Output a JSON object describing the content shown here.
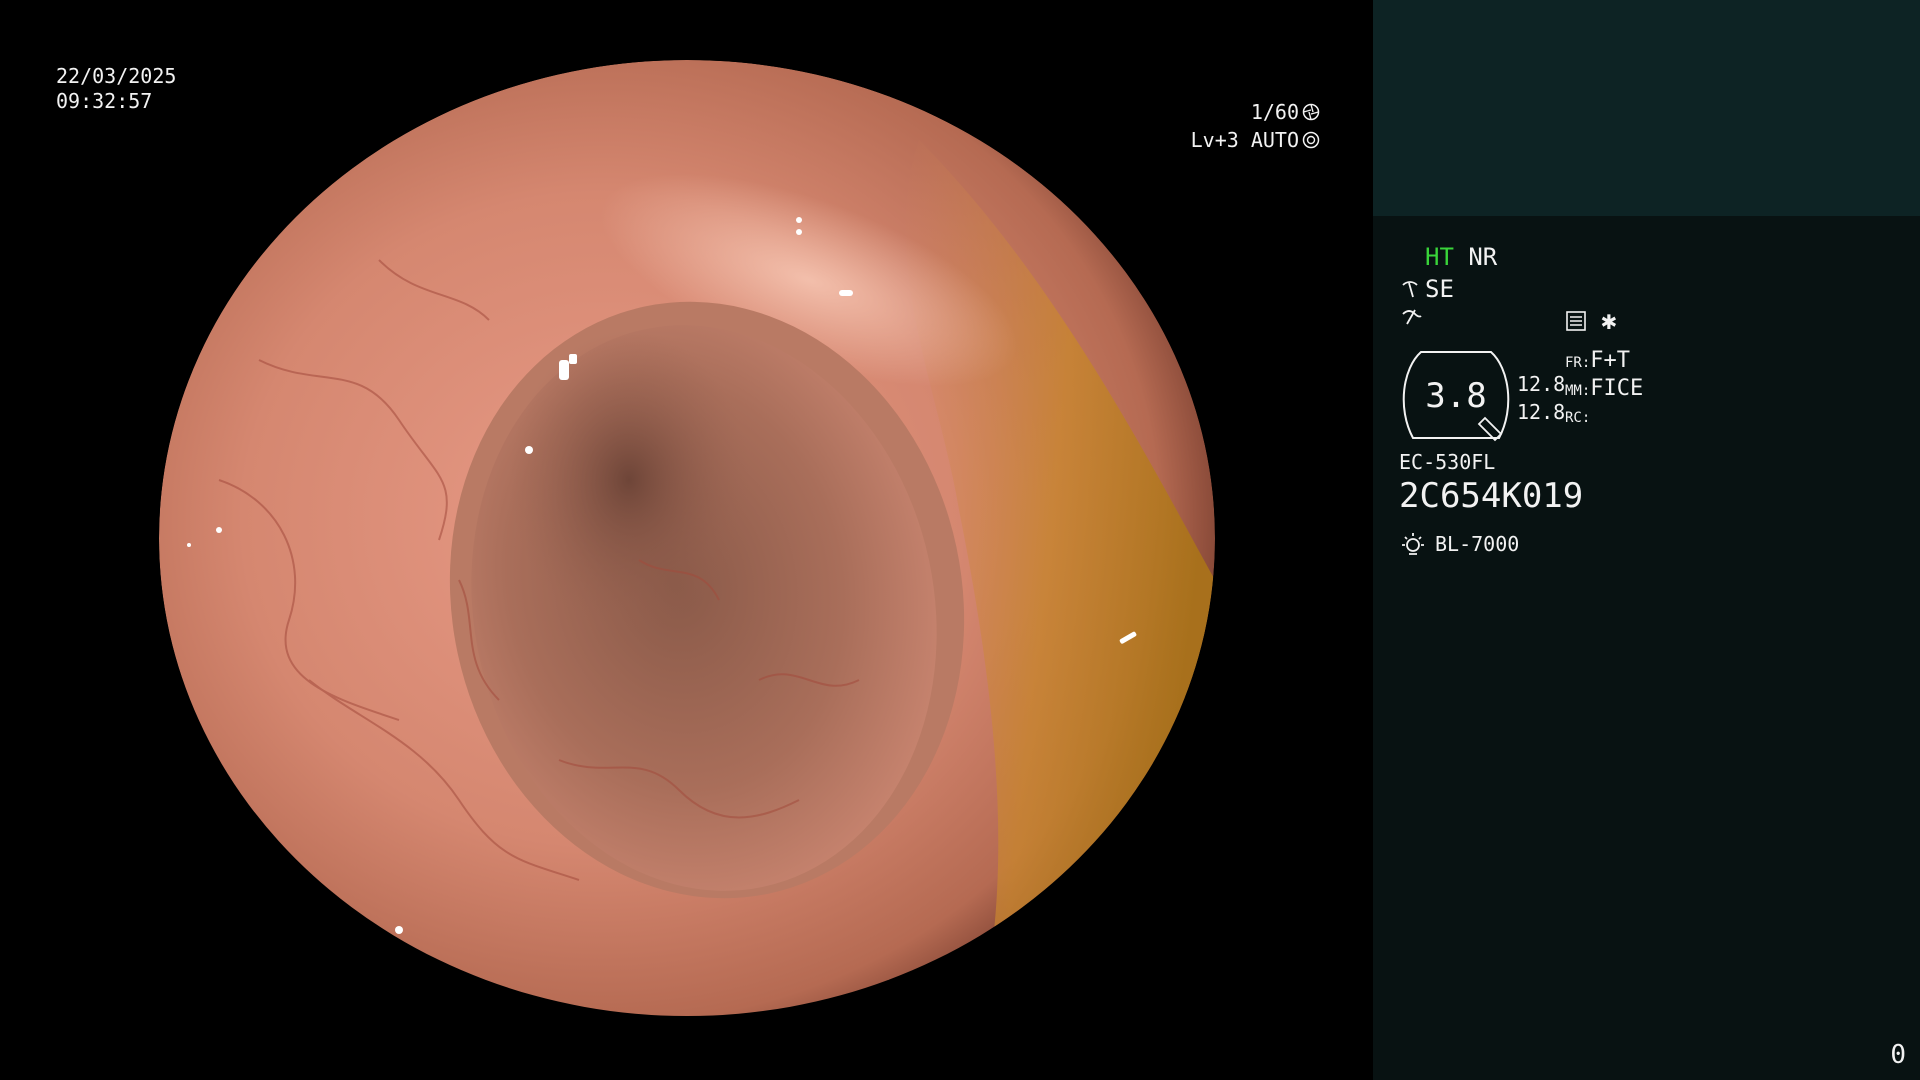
{
  "overlay": {
    "date": "22/03/2025",
    "time": "09:32:57",
    "shutter": "1/60",
    "iris": "Lv+3 AUTO"
  },
  "panel": {
    "ht": "HT",
    "nr": "NR",
    "se": "SE",
    "gauge_value": "3.8",
    "val_top": "12.8",
    "val_bottom": "12.8",
    "fr_label": "FR:",
    "fr_value": "F+T",
    "mm_label": "MM:",
    "mm_value": "FICE",
    "rc_label": "RC:",
    "model": "EC-530FL",
    "serial": "2C654K019",
    "light_source": "BL-7000",
    "counter": "0"
  },
  "colors": {
    "panel_bg": "#081212",
    "panel_top_bg": "#0d2324",
    "ht_green": "#39d43a"
  }
}
